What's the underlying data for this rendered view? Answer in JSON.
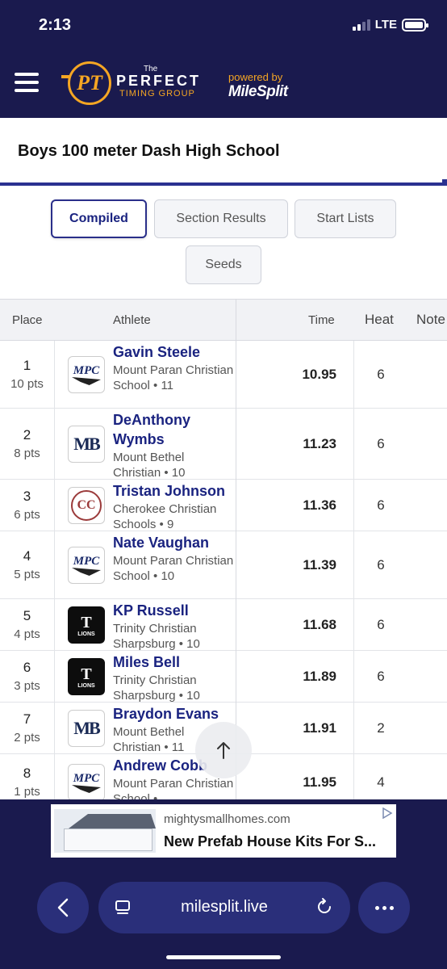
{
  "status": {
    "time": "2:13",
    "network": "LTE"
  },
  "header": {
    "logo_the": "The",
    "logo_initials": "PT",
    "logo_word": "PERFECT",
    "logo_sub": "TIMING GROUP",
    "powered_by": "powered by",
    "partner": "MileSplit"
  },
  "event": {
    "title": "Boys 100 meter Dash High School"
  },
  "tabs": {
    "compiled": "Compiled",
    "section_results": "Section Results",
    "start_lists": "Start Lists",
    "seeds": "Seeds"
  },
  "table": {
    "columns": {
      "place": "Place",
      "athlete": "Athlete",
      "time": "Time",
      "heat": "Heat",
      "note": "Note"
    },
    "rows": [
      {
        "place": "1",
        "pts": "10 pts",
        "name": "Gavin Steele",
        "school": "Mount Paran Christian School • 11",
        "logo": "MPC",
        "logo_style": "mpc",
        "time": "10.95",
        "heat": "6"
      },
      {
        "place": "2",
        "pts": "8 pts",
        "name": "DeAnthony Wymbs",
        "school": "Mount Bethel Christian • 10",
        "logo": "MB",
        "logo_style": "mb",
        "time": "11.23",
        "heat": "6"
      },
      {
        "place": "3",
        "pts": "6 pts",
        "name": "Tristan Johnson",
        "school": "Cherokee Christian Schools • 9",
        "logo": "CC",
        "logo_style": "cc",
        "time": "11.36",
        "heat": "6"
      },
      {
        "place": "4",
        "pts": "5 pts",
        "name": "Nate Vaughan",
        "school": "Mount Paran Christian School • 10",
        "logo": "MPC",
        "logo_style": "mpc",
        "time": "11.39",
        "heat": "6"
      },
      {
        "place": "5",
        "pts": "4 pts",
        "name": "KP Russell",
        "school": "Trinity Christian Sharpsburg • 10",
        "logo": "T",
        "logo_sub": "LIONS",
        "logo_style": "tc",
        "time": "11.68",
        "heat": "6"
      },
      {
        "place": "6",
        "pts": "3 pts",
        "name": "Miles Bell",
        "school": "Trinity Christian Sharpsburg • 10",
        "logo": "T",
        "logo_sub": "LIONS",
        "logo_style": "tc",
        "time": "11.89",
        "heat": "6"
      },
      {
        "place": "7",
        "pts": "2 pts",
        "name": "Braydon Evans",
        "school": "Mount Bethel Christian • 11",
        "logo": "MB",
        "logo_style": "mb",
        "time": "11.91",
        "heat": "2"
      },
      {
        "place": "8",
        "pts": "1 pts",
        "name": "Andrew Cobb",
        "school": "Mount Paran Christian School •",
        "logo": "MPC",
        "logo_style": "mpc",
        "time": "11.95",
        "heat": "4"
      }
    ]
  },
  "ad": {
    "domain": "mightysmallhomes.com",
    "title": "New Prefab House Kits For S..."
  },
  "browser": {
    "url": "milesplit.live"
  },
  "colors": {
    "brand_navy": "#1a1a4e",
    "accent_orange": "#f5a623",
    "link_blue": "#1a2380"
  }
}
